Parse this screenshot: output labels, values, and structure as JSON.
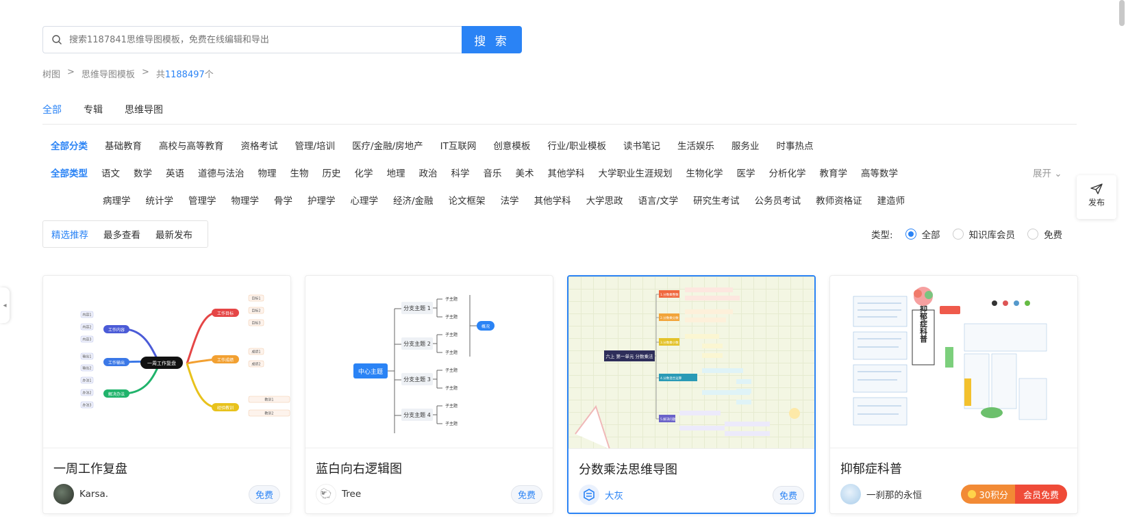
{
  "search": {
    "placeholder": "搜索1187841思维导图模板，免费在线编辑和导出",
    "button": "搜 索"
  },
  "breadcrumb": {
    "home": "树图",
    "sep1": ">",
    "section": "思维导图模板",
    "sep2": ">",
    "count_prefix": "共",
    "count": "1188497",
    "count_suffix": "个"
  },
  "tabs": [
    "全部",
    "专辑",
    "思维导图"
  ],
  "categories": {
    "lead": "全部分类",
    "items": [
      "基础教育",
      "高校与高等教育",
      "资格考试",
      "管理/培训",
      "医疗/金融/房地产",
      "IT互联网",
      "创意模板",
      "行业/职业模板",
      "读书笔记",
      "生活娱乐",
      "服务业",
      "时事热点"
    ]
  },
  "types": {
    "lead": "全部类型",
    "row1": [
      "语文",
      "数学",
      "英语",
      "道德与法治",
      "物理",
      "生物",
      "历史",
      "化学",
      "地理",
      "政治",
      "科学",
      "音乐",
      "美术",
      "其他学科",
      "大学职业生涯规划",
      "生物化学",
      "医学",
      "分析化学",
      "教育学",
      "高等数学"
    ],
    "row2": [
      "病理学",
      "统计学",
      "管理学",
      "物理学",
      "骨学",
      "护理学",
      "心理学",
      "经济/金融",
      "论文框架",
      "法学",
      "其他学科",
      "大学思政",
      "语言/文学",
      "研究生考试",
      "公务员考试",
      "教师资格证",
      "建造师"
    ],
    "expand": "展开"
  },
  "sort": [
    "精选推荐",
    "最多查看",
    "最新发布"
  ],
  "filter": {
    "label": "类型:",
    "options": [
      "全部",
      "知识库会员",
      "免费"
    ]
  },
  "publish": "发布",
  "cards": [
    {
      "title": "一周工作复盘",
      "author": "Karsa.",
      "tag": "免费",
      "thumb": {
        "center": "一周工作复盘",
        "b1": "工作内容",
        "b2": "工作输出",
        "b3": "解决办法",
        "b4": "工作目标",
        "b5": "工作成绩",
        "b6": "经验教训",
        "leaves_left": [
          "内容1",
          "内容2",
          "内容3",
          "输出1",
          "输出2",
          "办法1",
          "办法2",
          "办法3"
        ],
        "leaves_right": [
          "目标1",
          "目标2",
          "目标3",
          "成绩1",
          "成绩2",
          "教训1",
          "教训2"
        ]
      }
    },
    {
      "title": "蓝白向右逻辑图",
      "author": "Tree",
      "tag": "免费",
      "thumb": {
        "center": "中心主题",
        "branches": [
          "分支主题 1",
          "分支主题 2",
          "分支主题 3",
          "分支主题 4"
        ],
        "sub": "子主题",
        "summary": "概况"
      }
    },
    {
      "title": "分数乘法思维导图",
      "author": "大灰",
      "tag": "免费",
      "thumb": {
        "center": "六上 第一单元 分数乘法",
        "items": [
          "1.分数乘整数",
          "2.分数乘分数",
          "3.分数乘小数",
          "4.分数混合运算",
          "5.解决问题"
        ]
      }
    },
    {
      "title": "抑郁症科普",
      "author": "一刹那的永恒",
      "points": "30积分",
      "member": "会员免费",
      "thumb": {
        "banner": "抑郁症科普"
      }
    }
  ],
  "colors": {
    "accent": "#2a83f5",
    "premium_orange": "#f28a35",
    "premium_red": "#ef4b38"
  }
}
